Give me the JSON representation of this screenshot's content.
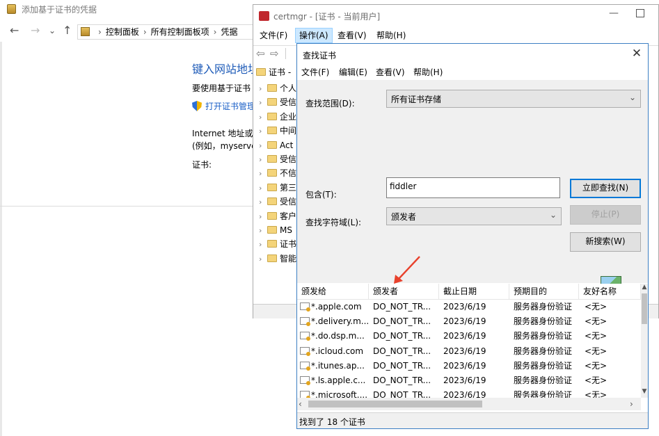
{
  "background_window": {
    "title": "添加基于证书的凭据",
    "nav": {
      "back_glyph": "←",
      "forward_glyph": "→",
      "dropdown_glyph": "⌄",
      "up_glyph": "↑"
    },
    "breadcrumb": [
      "控制面板",
      "所有控制面板项",
      "凭据"
    ],
    "heading": "键入网站地址",
    "prompt": "要使用基于证书",
    "link": "打开证书管理",
    "internet_line1": "Internet 地址或",
    "internet_line2": "(例如，myserve",
    "cert_label": "证书:"
  },
  "certmgr": {
    "title": "certmgr - [证书 - 当前用户]",
    "menu": [
      "文件(F)",
      "操作(A)",
      "查看(V)",
      "帮助(H)"
    ],
    "active_menu_index": 1,
    "tree_root": "证书 -",
    "tree_items": [
      "个人",
      "受信",
      "企业",
      "中间",
      "Act",
      "受信",
      "不信",
      "第三",
      "受信",
      "客户",
      "MS",
      "证书",
      "智能"
    ]
  },
  "find_dialog": {
    "title": "查找证书",
    "menu": [
      "文件(F)",
      "编辑(E)",
      "查看(V)",
      "帮助(H)"
    ],
    "scope_label": "查找范围(D):",
    "scope_value": "所有证书存储",
    "contains_label": "包含(T):",
    "contains_value": "fiddler",
    "field_label": "查找字符域(L):",
    "field_value": "颁发者",
    "find_now": "立即查找(N)",
    "stop": "停止(P)",
    "new_search": "新搜索(W)",
    "columns": [
      "颁发给",
      "颁发者",
      "截止日期",
      "预期目的",
      "友好名称"
    ],
    "rows": [
      [
        "*.apple.com",
        "DO_NOT_TR...",
        "2023/6/19",
        "服务器身份验证",
        "<无>"
      ],
      [
        "*.delivery.m...",
        "DO_NOT_TR...",
        "2023/6/19",
        "服务器身份验证",
        "<无>"
      ],
      [
        "*.do.dsp.m...",
        "DO_NOT_TR...",
        "2023/6/19",
        "服务器身份验证",
        "<无>"
      ],
      [
        "*.icloud.com",
        "DO_NOT_TR...",
        "2023/6/19",
        "服务器身份验证",
        "<无>"
      ],
      [
        "*.itunes.ap...",
        "DO_NOT_TR...",
        "2023/6/19",
        "服务器身份验证",
        "<无>"
      ],
      [
        "*.ls.apple.c...",
        "DO_NOT_TR...",
        "2023/6/19",
        "服务器身份验证",
        "<无>"
      ],
      [
        "*.microsoft....",
        "DO_NOT_TR...",
        "2023/6/19",
        "服务器身份验证",
        "<无>"
      ]
    ],
    "status": "找到了 18 个证书"
  },
  "colors": {
    "accent": "#0078d7",
    "annotation": "#e8412c",
    "heading_blue": "#1e5bb8"
  }
}
